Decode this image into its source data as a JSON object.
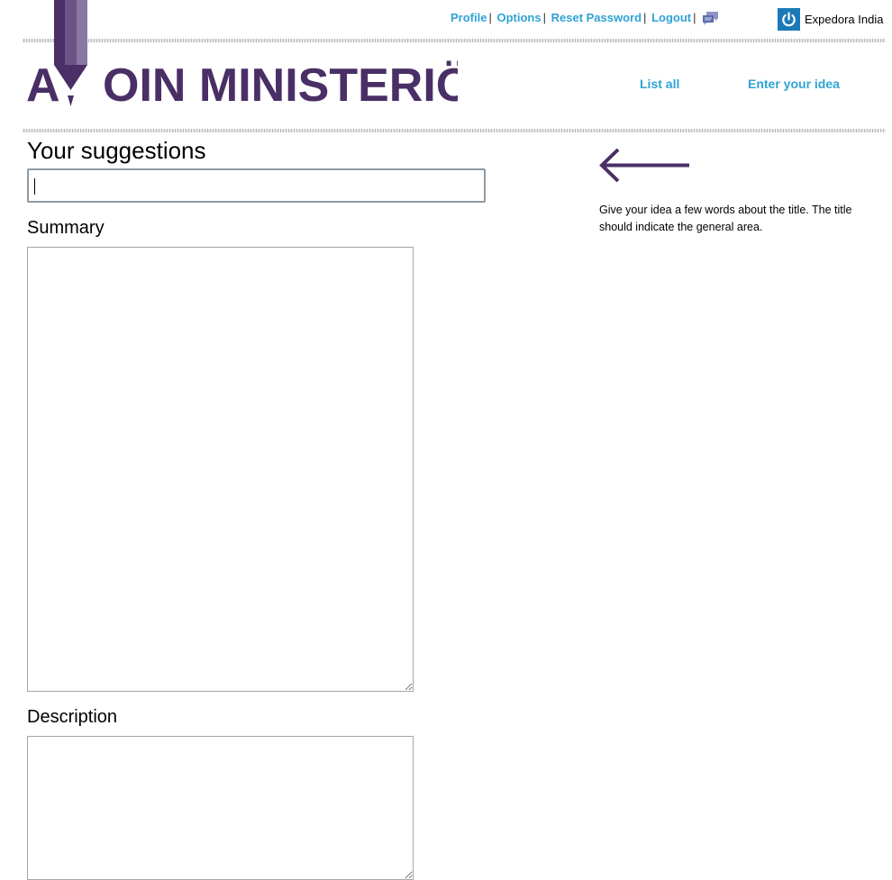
{
  "header": {
    "links": {
      "profile": "Profile",
      "options": "Options",
      "reset_password": "Reset Password",
      "logout": "Logout"
    },
    "separator": "|",
    "user_name": "Expedora India",
    "icons": {
      "chat": "chat-icon",
      "power": "power-icon"
    }
  },
  "logo": {
    "text_left": "A",
    "text_right": "OIN MINISTERIÖ",
    "icon": "pencil-icon"
  },
  "nav": {
    "list_all": "List all",
    "enter_idea": "Enter your idea"
  },
  "form": {
    "title_label": "Your suggestions",
    "title_value": "",
    "summary_label": "Summary",
    "summary_value": "",
    "description_label": "Description",
    "description_value": ""
  },
  "help": {
    "text": "Give your idea a few words about the title. The title should indicate the general area.",
    "icon": "arrow-left-icon"
  },
  "colors": {
    "link": "#2ea3d5",
    "brand": "#4a2f66",
    "power_bg": "#1a7ab8",
    "input_border": "#8e9ba5"
  }
}
